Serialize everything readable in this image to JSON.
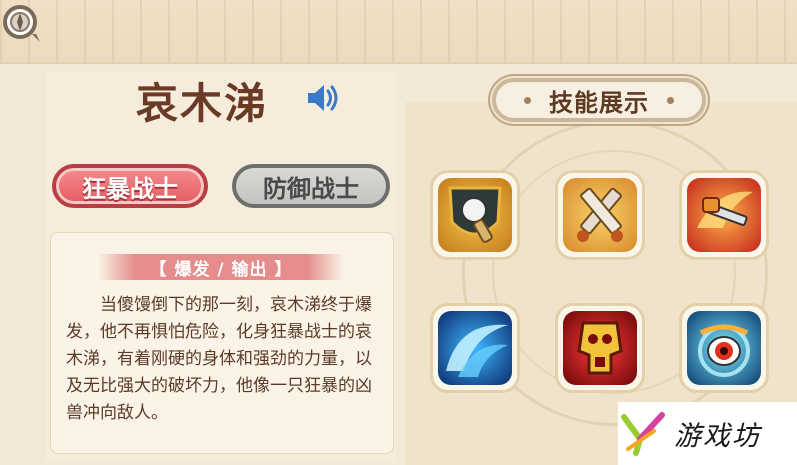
{
  "character": {
    "name": "哀木涕"
  },
  "modes": [
    {
      "label": "狂暴战士",
      "selected": true
    },
    {
      "label": "防御战士",
      "selected": false
    }
  ],
  "card": {
    "tag": "【 爆发 / 输出 】",
    "description": "当傻馒倒下的那一刻，哀木涕终于爆发，他不再惧怕危险，化身狂暴战士的哀木涕，有着刚硬的身体和强劲的力量，以及无比强大的破坏力，他像一只狂暴的凶兽冲向敌人。"
  },
  "skills": {
    "header": "技能展示",
    "items": [
      {
        "icon": "shield-fist-icon"
      },
      {
        "icon": "crossed-swords-icon"
      },
      {
        "icon": "flame-sword-icon"
      },
      {
        "icon": "water-slash-icon"
      },
      {
        "icon": "skull-banner-icon"
      },
      {
        "icon": "eye-vortex-icon"
      }
    ]
  },
  "watermark": {
    "text": "游戏坊"
  },
  "colors": {
    "accent_red": "#e45b62",
    "title_brown": "#6b3a26",
    "background": "#f3e9d6"
  }
}
